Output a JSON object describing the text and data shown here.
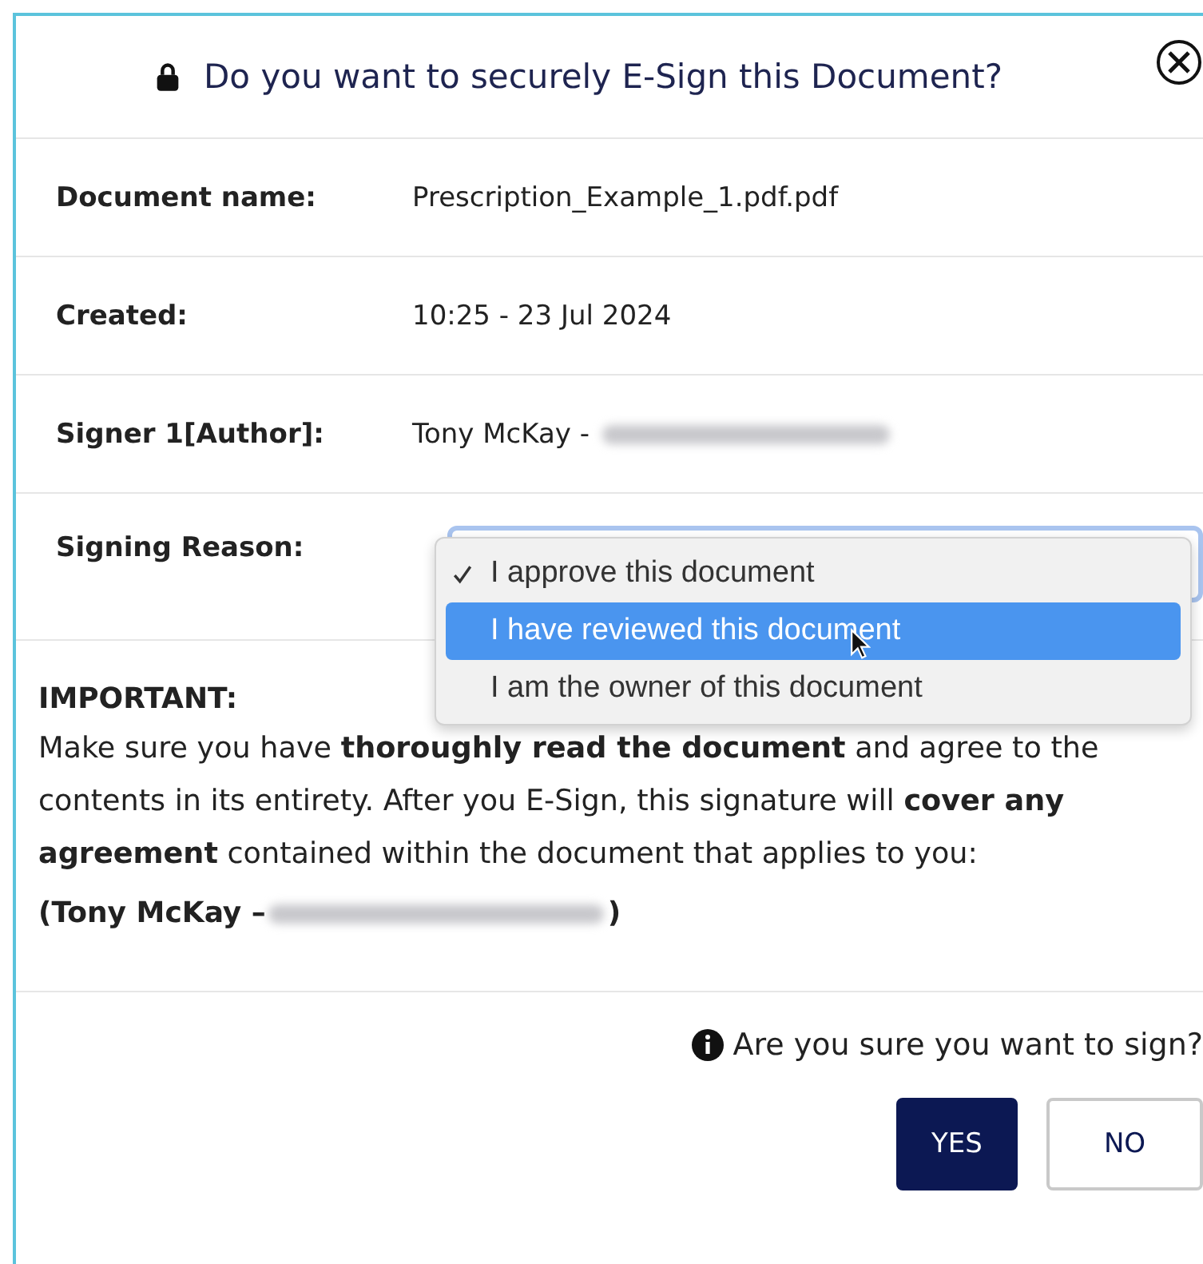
{
  "dialog": {
    "title": "Do you want to securely E-Sign this Document?"
  },
  "details": [
    {
      "label": "Document name:",
      "value": "Prescription_Example_1.pdf.pdf",
      "redacted": false
    },
    {
      "label": "Created:",
      "value": "10:25 - 23 Jul 2024",
      "redacted": false
    },
    {
      "label": "Signer 1[Author]:",
      "value": "Tony McKay -",
      "redacted": true
    }
  ],
  "signing_reason": {
    "label": "Signing Reason:",
    "options": [
      {
        "label": "I approve this document",
        "selected": true,
        "highlighted": false
      },
      {
        "label": "I have reviewed this document",
        "selected": false,
        "highlighted": true
      },
      {
        "label": "I am the owner of this document",
        "selected": false,
        "highlighted": false
      }
    ]
  },
  "important": {
    "heading": "IMPORTANT:",
    "text": "Make sure you have **thoroughly read the document** and agree to the contents in its entirety. After you E-Sign, this signature will **cover any agreement** contained within the document that applies to you:",
    "signer": "(Tony McKay –",
    "signer_end": ")"
  },
  "confirm": {
    "question": "Are you sure you want to sign?"
  },
  "buttons": [
    {
      "label": "YES",
      "kind": "primary"
    },
    {
      "label": "NO",
      "kind": "secondary"
    }
  ]
}
